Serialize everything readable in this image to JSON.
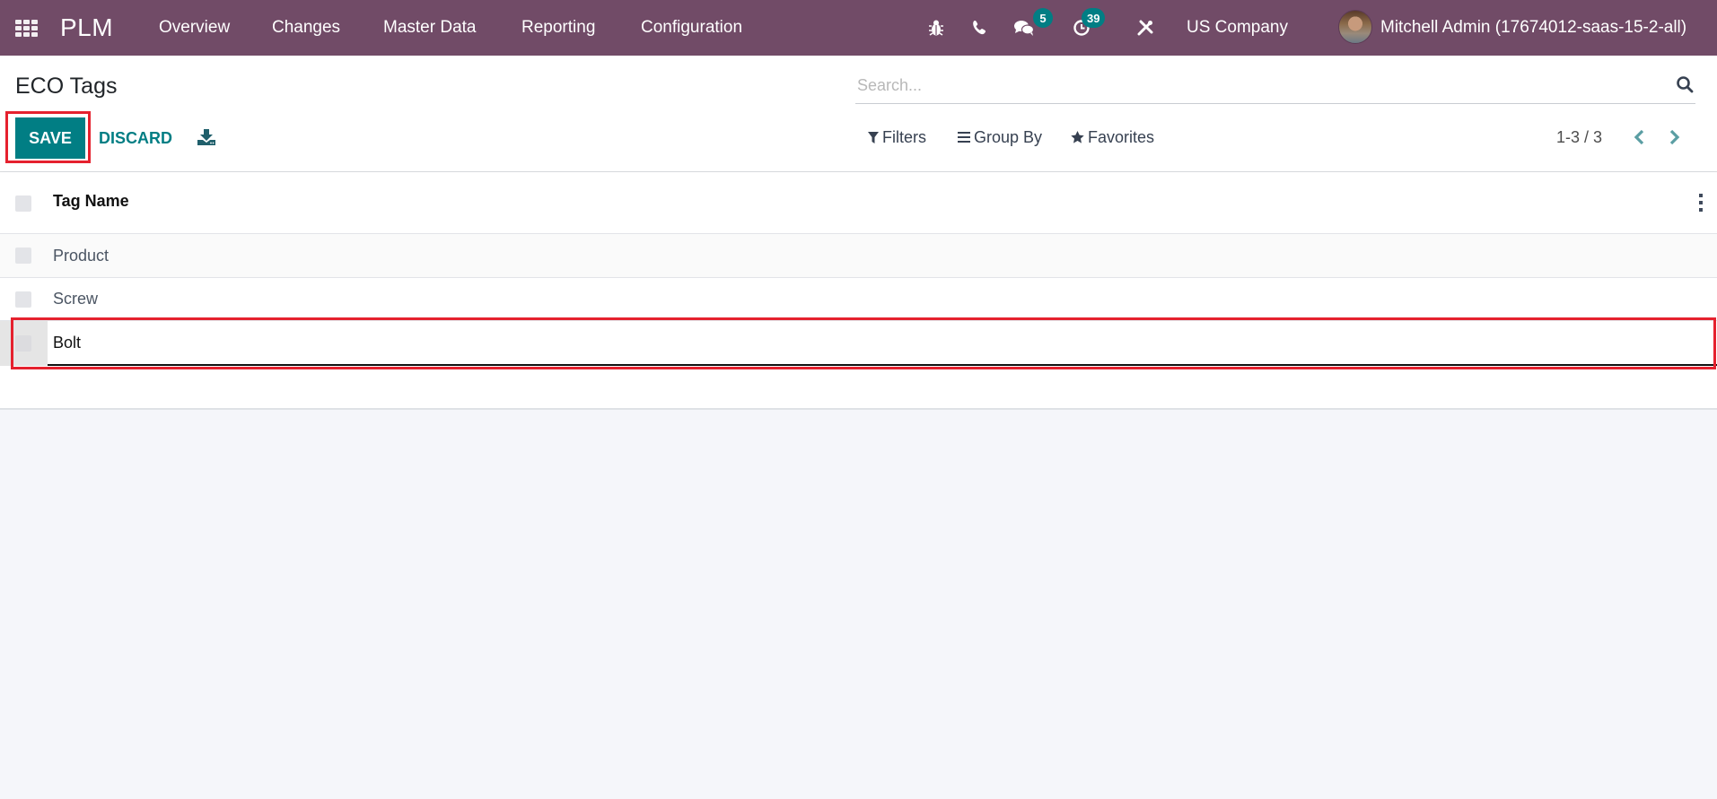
{
  "navbar": {
    "app_name": "PLM",
    "menu": [
      "Overview",
      "Changes",
      "Master Data",
      "Reporting",
      "Configuration"
    ],
    "icons": [
      "bug-icon",
      "phone-icon",
      "chat-icon",
      "activity-clock-icon",
      "tools-icon"
    ],
    "messages_badge": "5",
    "activities_badge": "39",
    "company": "US Company",
    "user": "Mitchell Admin (17674012-saas-15-2-all)",
    "bg_color": "#714b67"
  },
  "control_panel": {
    "title": "ECO Tags",
    "save_label": "SAVE",
    "discard_label": "DISCARD",
    "search_placeholder": "Search...",
    "search_value": "",
    "filters_label": "Filters",
    "groupby_label": "Group By",
    "favorites_label": "Favorites",
    "pager": "1-3 / 3",
    "accent_color": "#017e84"
  },
  "list": {
    "columns": [
      "Tag Name"
    ],
    "rows": [
      {
        "name": "Product"
      },
      {
        "name": "Screw"
      }
    ],
    "editing_row": {
      "name": "Bolt"
    }
  },
  "annotations": {
    "highlight_color": "#e5212e"
  }
}
